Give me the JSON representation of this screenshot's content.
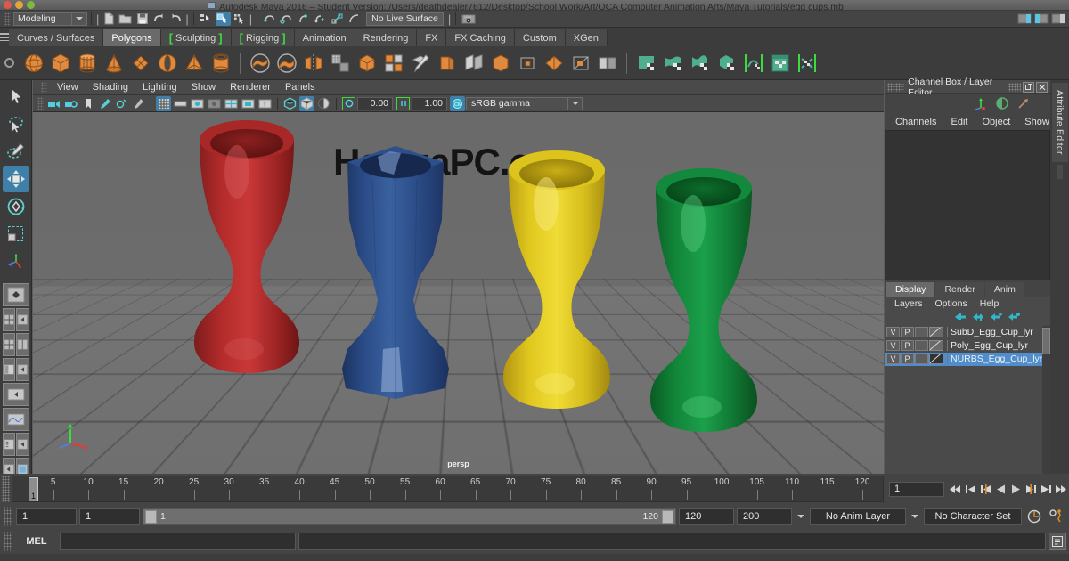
{
  "window": {
    "title": "Autodesk Maya 2016 – Student Version: /Users/deathdealer7612/Desktop/School Work/Art/OCA Computer Animation Arts/Maya Tutorials/egg cups.mb",
    "traffic_colors": {
      "close": "#e2574b",
      "minimize": "#e0a53c",
      "zoom": "#7db93d"
    }
  },
  "status_line": {
    "menu_set": "Modeling",
    "live_surface": "No Live Surface",
    "icons": [
      "new-scene-icon",
      "open-scene-icon",
      "save-scene-icon",
      "undo-icon",
      "redo-icon",
      "select-by-hierarchy-icon",
      "select-by-object-icon",
      "select-by-component-icon",
      "snap-to-grid-icon",
      "snap-to-curve-icon",
      "snap-to-point-icon",
      "snap-to-projected-center-icon",
      "snap-to-view-plane-icon",
      "make-live-icon",
      "render-view-icon",
      "render-current-frame-icon",
      "ipr-render-icon",
      "render-settings-icon"
    ]
  },
  "shelf": {
    "tabs": [
      {
        "label": "Curves / Surfaces",
        "active": false,
        "bracket": false
      },
      {
        "label": "Polygons",
        "active": true,
        "bracket": false
      },
      {
        "label": "Sculpting",
        "active": false,
        "bracket": true
      },
      {
        "label": "Rigging",
        "active": false,
        "bracket": true
      },
      {
        "label": "Animation",
        "active": false,
        "bracket": false
      },
      {
        "label": "Rendering",
        "active": false,
        "bracket": false
      },
      {
        "label": "FX",
        "active": false,
        "bracket": false
      },
      {
        "label": "FX Caching",
        "active": false,
        "bracket": false
      },
      {
        "label": "Custom",
        "active": false,
        "bracket": false
      },
      {
        "label": "XGen",
        "active": false,
        "bracket": false
      }
    ],
    "accent_orange": "#e08a40",
    "accent_green": "#4fae8c",
    "items": [
      "poly-sphere-icon",
      "poly-cube-icon",
      "poly-cylinder-icon",
      "poly-cone-icon",
      "poly-plane-icon",
      "poly-torus-icon",
      "poly-pyramid-icon",
      "poly-pipe-icon",
      "poly-boolean-union-icon",
      "poly-boolean-difference-icon",
      "poly-mirror-icon",
      "poly-smooth-icon",
      "poly-combine-icon",
      "poly-multicut-icon",
      "poly-extrude-icon",
      "poly-bevel-icon",
      "poly-bridge-icon",
      "poly-append-icon",
      "poly-wedge-icon",
      "poly-reduce-icon",
      "poly-triangulate-icon",
      "poly-quadrangulate-icon",
      "uv-planar-icon",
      "uv-cylindrical-icon",
      "uv-spherical-icon",
      "uv-automatic-icon",
      "uv-unfold-icon",
      "uv-editor-icon",
      "uv-optimize-icon"
    ]
  },
  "toolbox": {
    "tools": [
      {
        "name": "select-tool-icon",
        "active": false
      },
      {
        "name": "lasso-select-tool-icon",
        "active": false
      },
      {
        "name": "paint-select-tool-icon",
        "active": false
      },
      {
        "name": "move-tool-icon",
        "active": true
      },
      {
        "name": "rotate-tool-icon",
        "active": false
      },
      {
        "name": "scale-tool-icon",
        "active": false
      },
      {
        "name": "last-tool-used-icon",
        "active": false
      }
    ],
    "layouts": [
      "single-perspective-layout-icon",
      "four-view-layout-icon",
      "two-panes-side-layout-icon",
      "outliner-persp-layout-icon",
      "persp-graph-layout-icon",
      "hypershade-persp-layout-icon",
      "persp-uv-layout-icon"
    ]
  },
  "viewport": {
    "menus": [
      "View",
      "Shading",
      "Lighting",
      "Show",
      "Renderer",
      "Panels"
    ],
    "toolbar_icons": [
      "select-camera-icon",
      "camera-attributes-icon",
      "bookmark-icon",
      "image-plane-icon",
      "two-sided-lighting-icon",
      "shadows-icon",
      "grid-toggle-icon",
      "film-gate-icon",
      "resolution-gate-icon",
      "gate-mask-icon",
      "film-origin-icon",
      "xray-icon",
      "texture-icon",
      "wireframe-shaded-icon",
      "smooth-shade-all-icon",
      "hardware-texturing-icon"
    ],
    "exposure": "0.00",
    "gamma": "1.00",
    "view_transform": "sRGB gamma",
    "camera_label": "persp",
    "watermark": "HamzaPC.com",
    "background_color": "#6c6c6c",
    "grid_color": "#3a3a3a",
    "cups": [
      {
        "name": "egg-cup-red",
        "color": "#b32b2b",
        "dark": "#7a1a1a",
        "light": "#d65757",
        "faceted": false
      },
      {
        "name": "egg-cup-blue",
        "color": "#2f5599",
        "dark": "#1f3a6b",
        "light": "#6f8fc8",
        "faceted": true
      },
      {
        "name": "egg-cup-yellow",
        "color": "#e8d021",
        "dark": "#b8a215",
        "light": "#f5e87a",
        "faceted": false
      },
      {
        "name": "egg-cup-green",
        "color": "#16903c",
        "dark": "#0c5e26",
        "light": "#4ec072",
        "faceted": false
      }
    ]
  },
  "channel_box": {
    "title": "Channel Box / Layer Editor",
    "menus": [
      "Channels",
      "Edit",
      "Object",
      "Show"
    ],
    "header_icons": [
      "axis-tripod-icon",
      "shading-sphere-icon",
      "arrow-up-right-icon"
    ],
    "window_buttons": [
      "undock-icon",
      "close-icon"
    ]
  },
  "layer_editor": {
    "tabs": [
      {
        "label": "Display",
        "active": true
      },
      {
        "label": "Render",
        "active": false
      },
      {
        "label": "Anim",
        "active": false
      }
    ],
    "menus": [
      "Layers",
      "Options",
      "Help"
    ],
    "toolbar_icons": [
      "move-layer-up-icon",
      "move-layer-down-icon",
      "new-layer-icon",
      "new-layer-from-selected-icon"
    ],
    "layers": [
      {
        "visibility": "V",
        "playback": "P",
        "state": "",
        "name": "SubD_Egg_Cup_lyr",
        "selected": false
      },
      {
        "visibility": "V",
        "playback": "P",
        "state": "",
        "name": "Poly_Egg_Cup_lyr",
        "selected": false
      },
      {
        "visibility": "V",
        "playback": "P",
        "state": "",
        "name": "NURBS_Egg_Cup_lyr",
        "selected": true
      }
    ],
    "selected_color": "#4f8dcc"
  },
  "right_tabs": [
    {
      "label": "Attribute Editor"
    },
    {
      "label": "Channel Box / Layer Editor"
    }
  ],
  "timeline": {
    "start": 1,
    "end": 120,
    "current_frame": "1",
    "tick_labels": [
      "5",
      "10",
      "15",
      "20",
      "25",
      "30",
      "35",
      "40",
      "45",
      "50",
      "55",
      "60",
      "65",
      "70",
      "75",
      "80",
      "85",
      "90",
      "95",
      "100",
      "105",
      "110",
      "115",
      "120"
    ],
    "playhead_label": "1",
    "playback_buttons": [
      "go-to-start-icon",
      "step-back-keyframe-icon",
      "step-back-frame-icon",
      "play-backwards-icon",
      "play-forwards-icon",
      "step-forward-frame-icon",
      "step-forward-keyframe-icon",
      "go-to-end-icon"
    ]
  },
  "range_slider": {
    "anim_start": "1",
    "range_start": "1",
    "slider_start_label": "1",
    "slider_end_label": "120",
    "range_end": "120",
    "anim_end": "200",
    "anim_layer": "No Anim Layer",
    "character_set": "No Character Set",
    "buttons": [
      "auto-keyframe-icon",
      "animation-preferences-icon"
    ]
  },
  "command_line": {
    "language_label": "MEL",
    "input_value": "",
    "output_value": "",
    "script_editor_button": "script-editor-icon"
  }
}
